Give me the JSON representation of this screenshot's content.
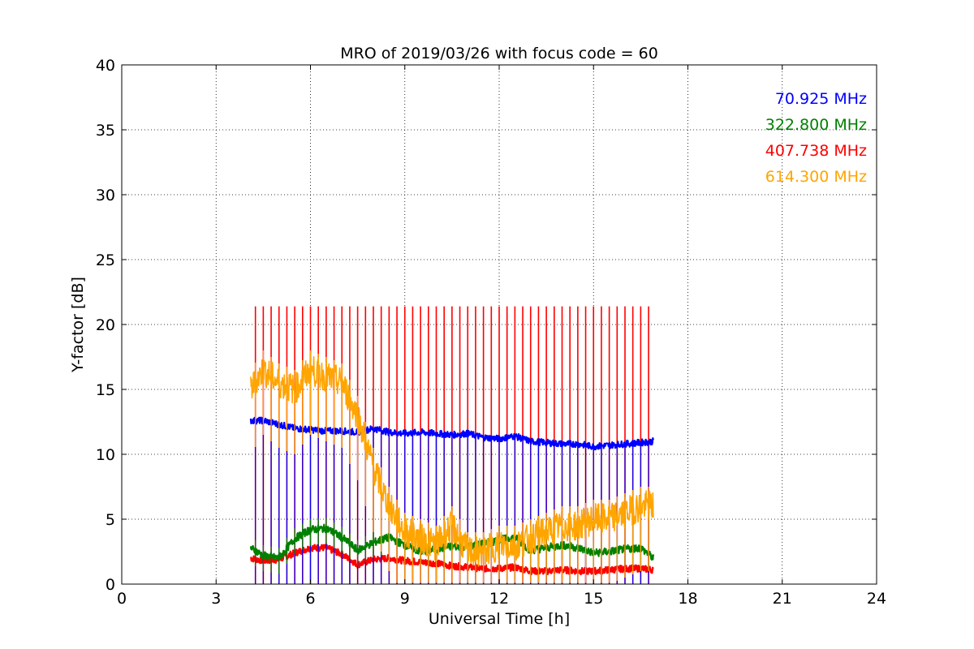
{
  "chart_data": {
    "type": "line",
    "title": "MRO of 2019/03/26 with focus code = 60",
    "xlabel": "Universal Time [h]",
    "ylabel": "Y-factor [dB]",
    "xlim": [
      0,
      24
    ],
    "ylim": [
      0,
      40
    ],
    "xticks": [
      0,
      3,
      6,
      9,
      12,
      15,
      18,
      21,
      24
    ],
    "yticks": [
      0,
      5,
      10,
      15,
      20,
      25,
      30,
      35,
      40
    ],
    "grid": true,
    "legend_placement": "top-right",
    "spike_top": 21.4,
    "spike_period_h": 0.25,
    "spike_start_h": 4.25,
    "spike_end_h": 16.75,
    "series": [
      {
        "name": "70.925 MHz",
        "color": "#0000ff",
        "x": [
          4.1,
          4.5,
          5.0,
          5.5,
          6.0,
          6.5,
          7.0,
          7.5,
          8.0,
          8.5,
          9.0,
          9.5,
          10.0,
          10.5,
          11.0,
          11.5,
          12.0,
          12.5,
          13.0,
          13.5,
          14.0,
          14.5,
          15.0,
          15.5,
          16.0,
          16.5,
          16.9
        ],
        "y": [
          12.6,
          12.6,
          12.3,
          12.0,
          11.9,
          11.8,
          11.8,
          11.7,
          12.0,
          11.7,
          11.6,
          11.7,
          11.6,
          11.5,
          11.6,
          11.3,
          11.2,
          11.4,
          11.0,
          10.9,
          10.8,
          10.8,
          10.6,
          10.7,
          10.8,
          10.9,
          11.0
        ]
      },
      {
        "name": "322.800 MHz",
        "color": "#008000",
        "x": [
          4.1,
          4.5,
          5.0,
          5.5,
          6.0,
          6.5,
          7.0,
          7.5,
          8.0,
          8.5,
          9.0,
          9.5,
          10.0,
          10.5,
          11.0,
          11.5,
          12.0,
          12.5,
          13.0,
          13.5,
          14.0,
          14.5,
          15.0,
          15.5,
          16.0,
          16.5,
          16.9
        ],
        "y": [
          2.8,
          2.2,
          2.0,
          3.5,
          4.2,
          4.3,
          3.6,
          2.6,
          3.2,
          3.6,
          3.0,
          2.5,
          2.7,
          2.9,
          2.9,
          3.1,
          3.4,
          3.6,
          2.6,
          2.8,
          3.0,
          2.8,
          2.4,
          2.5,
          2.7,
          2.8,
          2.0
        ]
      },
      {
        "name": "407.738 MHz",
        "color": "#ff0000",
        "x": [
          4.1,
          4.5,
          5.0,
          5.5,
          6.0,
          6.5,
          7.0,
          7.5,
          8.0,
          8.5,
          9.0,
          9.5,
          10.0,
          10.5,
          11.0,
          11.5,
          12.0,
          12.5,
          13.0,
          13.5,
          14.0,
          14.5,
          15.0,
          15.5,
          16.0,
          16.5,
          16.9
        ],
        "y": [
          2.0,
          1.8,
          1.9,
          2.4,
          2.8,
          2.8,
          2.3,
          1.5,
          1.9,
          2.0,
          1.8,
          1.7,
          1.6,
          1.4,
          1.3,
          1.2,
          1.2,
          1.3,
          1.0,
          1.0,
          1.1,
          1.0,
          1.0,
          1.1,
          1.2,
          1.2,
          1.1
        ]
      },
      {
        "name": "614.300 MHz",
        "color": "#ffa500",
        "x": [
          4.1,
          4.5,
          5.0,
          5.5,
          6.0,
          6.5,
          7.0,
          7.5,
          8.0,
          8.5,
          9.0,
          9.5,
          10.0,
          10.5,
          11.0,
          11.5,
          12.0,
          12.5,
          13.0,
          13.5,
          14.0,
          14.5,
          15.0,
          15.5,
          16.0,
          16.5,
          16.9
        ],
        "y": [
          15.0,
          16.5,
          15.5,
          15.0,
          16.5,
          16.0,
          15.5,
          13.0,
          9.0,
          6.0,
          4.0,
          3.5,
          3.0,
          4.5,
          2.5,
          2.5,
          3.0,
          3.0,
          3.5,
          4.0,
          4.5,
          4.5,
          5.0,
          5.0,
          5.5,
          6.0,
          6.0
        ]
      }
    ]
  }
}
